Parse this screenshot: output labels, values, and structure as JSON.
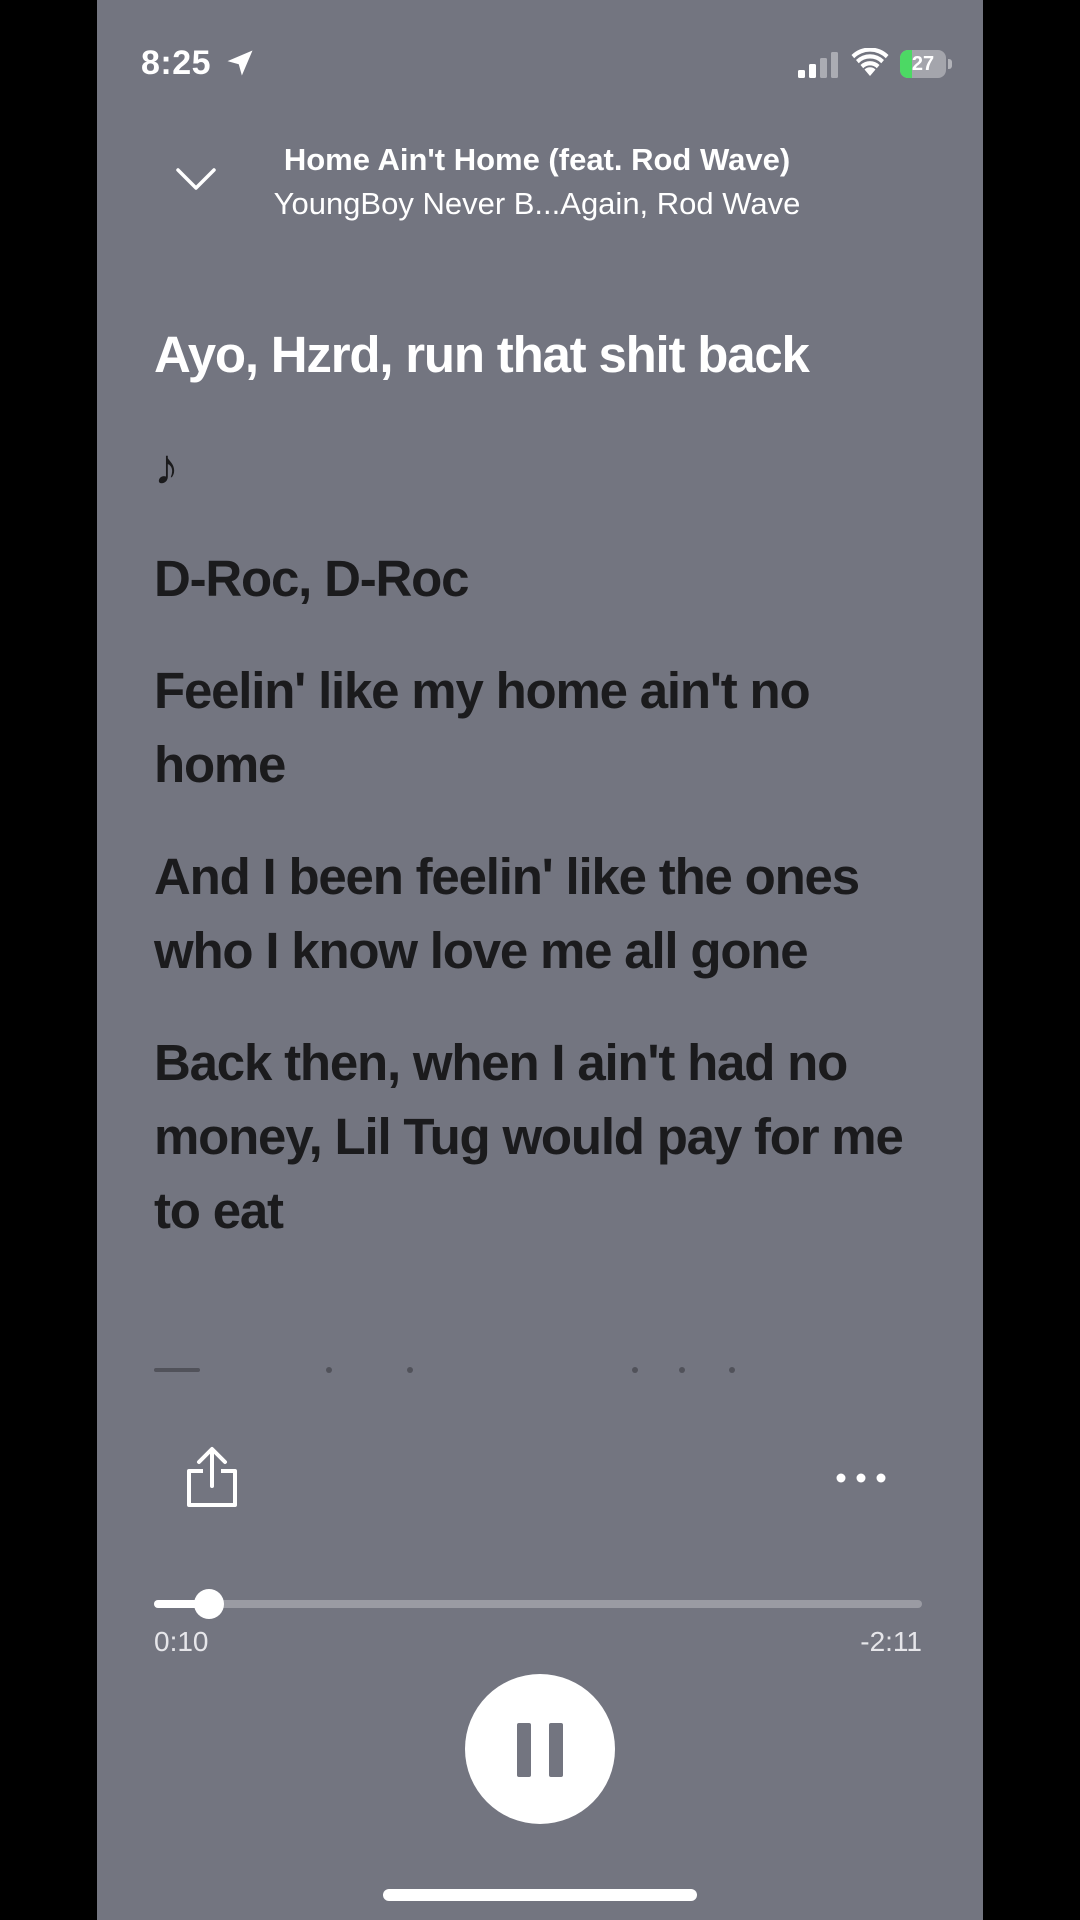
{
  "status_bar": {
    "time": "8:25",
    "battery_level": "27",
    "battery_charging": true,
    "battery_fraction": 0.27,
    "icons": [
      "location-arrow-icon",
      "cellular-signal-icon",
      "wifi-icon",
      "battery-icon"
    ]
  },
  "header": {
    "collapse_icon": "chevron-down-icon",
    "song_title": "Home Ain't Home (feat. Rod Wave)",
    "artist": "YoungBoy Never B...Again, Rod Wave"
  },
  "lyrics": [
    {
      "text": "Ayo, Hzrd, run that shit back",
      "active": true
    },
    {
      "text": "♪",
      "active": false
    },
    {
      "text": "D-Roc, D-Roc",
      "active": false
    },
    {
      "text": "Feelin' like my home ain't no home",
      "active": false
    },
    {
      "text": "And I been feelin' like the ones who I know love me all gone",
      "active": false
    },
    {
      "text": "Back then, when I ain't had no money, Lil Tug would pay for me to eat",
      "active": false
    }
  ],
  "actions": {
    "share_icon": "share-icon",
    "more_icon": "more-options-icon"
  },
  "player": {
    "elapsed": "0:10",
    "remaining": "-2:11",
    "progress_fraction": 0.071,
    "play_state": "playing",
    "play_pause_icon": "pause-icon"
  },
  "colors": {
    "background": "#737580",
    "active_lyric": "#ffffff",
    "inactive_lyric": "#1b1b1d",
    "battery_green": "#4cd964"
  }
}
